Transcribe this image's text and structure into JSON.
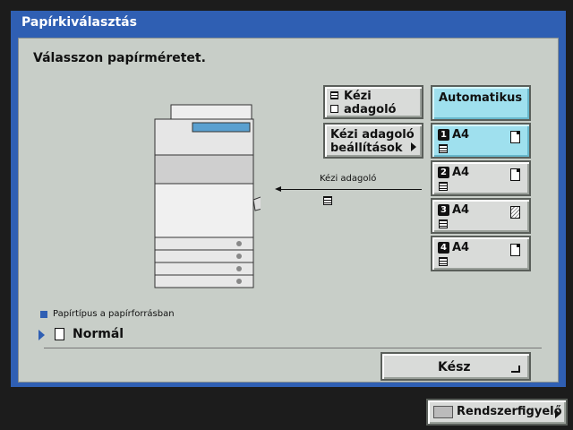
{
  "window": {
    "title": "Papírkiválasztás"
  },
  "prompt": "Válasszon papírméretet.",
  "manual_feeder_btn": {
    "line1": "Kézi",
    "line2": "adagoló"
  },
  "manual_settings_btn": {
    "line1": "Kézi adagoló",
    "line2": "beállítások"
  },
  "auto_btn": {
    "label": "Automatikus",
    "selected": true
  },
  "trays": [
    {
      "num": "1",
      "size": "A4",
      "paper_icon": "paper-folded-corner",
      "selected": true
    },
    {
      "num": "2",
      "size": "A4",
      "paper_icon": "paper-folded-corner",
      "selected": false
    },
    {
      "num": "3",
      "size": "A4",
      "paper_icon": "paper-hatched",
      "selected": false
    },
    {
      "num": "4",
      "size": "A4",
      "paper_icon": "paper-folded-corner",
      "selected": false
    }
  ],
  "copier_label": "Kézi adagoló",
  "paper_type_heading": "Papírtípus a papírforrásban",
  "paper_type_value": "Normál",
  "done_btn": "Kész",
  "footer": {
    "status_monitor": "Rendszerfigyelő"
  },
  "colors": {
    "title_bar": "#2f5fb3",
    "panel": "#c8cec8",
    "selected": "#9fe0ee",
    "background": "#1c1c1c"
  }
}
